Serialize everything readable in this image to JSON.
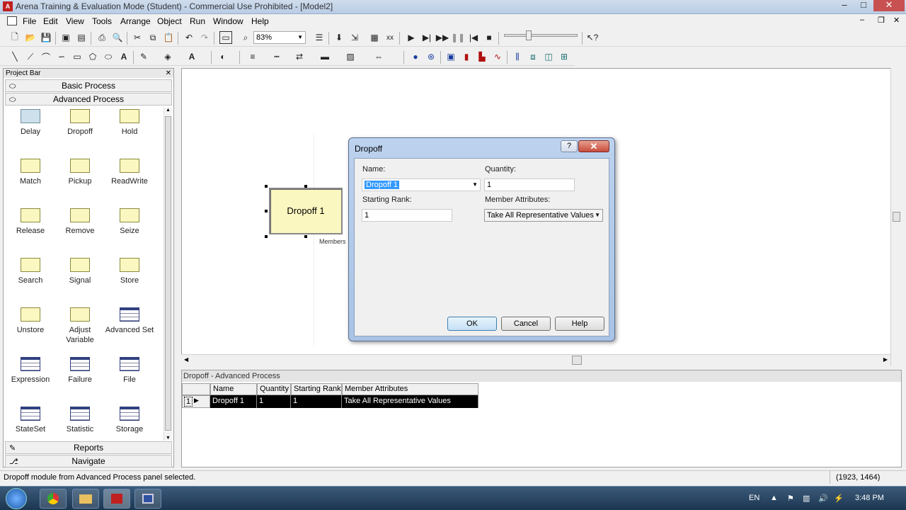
{
  "window": {
    "title": "Arena Training & Evaluation Mode (Student) - Commercial Use Prohibited - [Model2]",
    "app_icon": "arena-icon"
  },
  "menu": [
    "File",
    "Edit",
    "View",
    "Tools",
    "Arrange",
    "Object",
    "Run",
    "Window",
    "Help"
  ],
  "toolbar": {
    "zoom_value": "83%"
  },
  "project_bar": {
    "title": "Project Bar",
    "panels": {
      "basic": "Basic Process",
      "advanced": "Advanced Process",
      "reports": "Reports",
      "navigate": "Navigate"
    },
    "modules": [
      {
        "label": "Delay",
        "icon": "delay-icon"
      },
      {
        "label": "Dropoff",
        "icon": "dropoff-icon"
      },
      {
        "label": "Hold",
        "icon": "hold-icon"
      },
      {
        "label": "Match",
        "icon": "match-icon"
      },
      {
        "label": "Pickup",
        "icon": "pickup-icon"
      },
      {
        "label": "ReadWrite",
        "icon": "readwrite-icon"
      },
      {
        "label": "Release",
        "icon": "release-icon"
      },
      {
        "label": "Remove",
        "icon": "remove-icon"
      },
      {
        "label": "Seize",
        "icon": "seize-icon"
      },
      {
        "label": "Search",
        "icon": "search-module-icon"
      },
      {
        "label": "Signal",
        "icon": "signal-icon"
      },
      {
        "label": "Store",
        "icon": "store-icon"
      },
      {
        "label": "Unstore",
        "icon": "unstore-icon"
      },
      {
        "label": "Adjust Variable",
        "icon": "adjust-variable-icon"
      },
      {
        "label": "Advanced Set",
        "icon": "advanced-set-icon"
      },
      {
        "label": "Expression",
        "icon": "expression-icon"
      },
      {
        "label": "Failure",
        "icon": "failure-icon"
      },
      {
        "label": "File",
        "icon": "file-icon"
      },
      {
        "label": "StateSet",
        "icon": "stateset-icon"
      },
      {
        "label": "Statistic",
        "icon": "statistic-icon"
      },
      {
        "label": "Storage",
        "icon": "storage-icon"
      }
    ]
  },
  "canvas": {
    "module_label": "Dropoff 1",
    "members_label": "Members"
  },
  "dialog": {
    "title": "Dropoff",
    "help_icon": "?",
    "close_icon": "✕",
    "name_label": "Name:",
    "name_value": "Dropoff 1",
    "quantity_label": "Quantity:",
    "quantity_value": "1",
    "starting_rank_label": "Starting Rank:",
    "starting_rank_value": "1",
    "member_attributes_label": "Member Attributes:",
    "member_attributes_value": "Take All Representative Values",
    "ok": "OK",
    "cancel": "Cancel",
    "help": "Help"
  },
  "spreadsheet": {
    "title": "Dropoff - Advanced Process",
    "columns": [
      "Name",
      "Quantity",
      "Starting Rank",
      "Member Attributes"
    ],
    "row": {
      "index": "1",
      "name": "Dropoff 1",
      "quantity": "1",
      "starting_rank": "1",
      "member_attributes": "Take All Representative Values"
    }
  },
  "status": {
    "message": "Dropoff module from Advanced Process panel selected.",
    "coords": "(1923, 1464)"
  },
  "taskbar": {
    "lang": "EN",
    "time": "3:48 PM"
  }
}
